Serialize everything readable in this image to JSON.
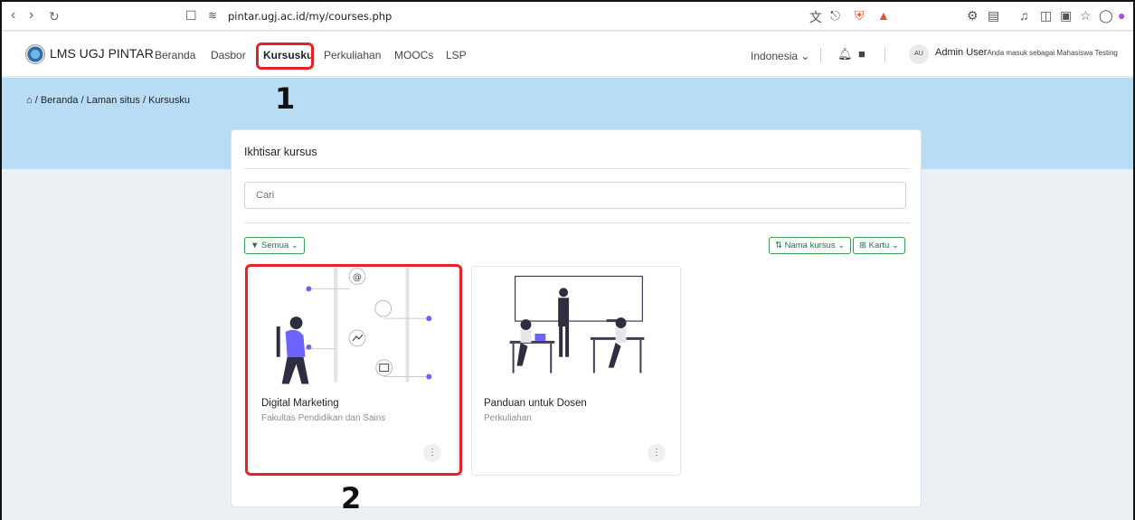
{
  "browser": {
    "url": "pintar.ugj.ac.id/my/courses.php"
  },
  "navbar": {
    "brand": "LMS UGJ PINTAR",
    "links": [
      "Beranda",
      "Dasbor",
      "Kursusku",
      "Perkuliahan",
      "MOOCs",
      "LSP"
    ],
    "language": "Indonesia",
    "avatar_initials": "AU",
    "avatar_sub": "MT",
    "user_name": "Admin User",
    "user_status": "Anda masuk sebagai Mahasiswa Testing"
  },
  "breadcrumb": [
    "Beranda",
    "Laman situs",
    "Kursusku"
  ],
  "annotations": [
    "1",
    "2"
  ],
  "overview": {
    "title": "Ikhtisar kursus",
    "search_placeholder": "Cari",
    "filter_label": "Semua",
    "sort_label": "Nama kursus",
    "view_label": "Kartu"
  },
  "courses": [
    {
      "title": "Digital Marketing",
      "category": "Fakultas Pendidikan dan Sains"
    },
    {
      "title": "Panduan untuk Dosen",
      "category": "Perkuliahan"
    }
  ],
  "colors": {
    "accent": "#e8202a",
    "hero": "#b7dcf3",
    "filter_green": "#3b9e55",
    "illustration_purple": "#6c63ff"
  }
}
